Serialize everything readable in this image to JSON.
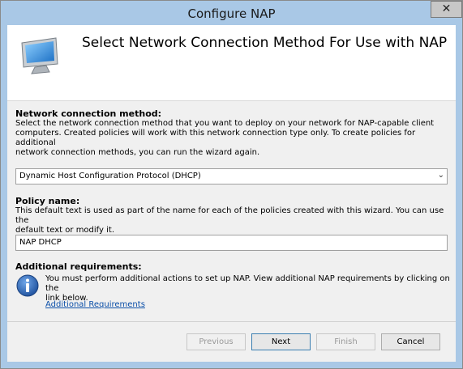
{
  "window": {
    "title": "Configure NAP",
    "close_glyph": "✕"
  },
  "header": {
    "title": "Select Network Connection Method For Use with NAP",
    "icon": "computer-monitor-icon"
  },
  "network_method": {
    "label": "Network connection method:",
    "description_lines": [
      "Select the network connection method that you want to deploy on your network for NAP-capable client",
      "computers. Created policies will work with this network connection type only. To create policies for additional",
      "network connection methods, you can run the wizard again."
    ],
    "selected": "Dynamic Host Configuration Protocol (DHCP)",
    "arrow_glyph": "⌄"
  },
  "policy_name": {
    "label": "Policy name:",
    "description_lines": [
      "This default text is used as part of the name for each of the policies created with this wizard. You can use the",
      "default text or modify it."
    ],
    "value": "NAP DHCP"
  },
  "additional": {
    "label": "Additional requirements:",
    "icon": "info-icon",
    "text_lines": [
      "You must perform additional actions to set up NAP. View additional NAP requirements by clicking on the",
      "link below."
    ],
    "link": "Additional Requirements"
  },
  "buttons": {
    "previous": "Previous",
    "next": "Next",
    "finish": "Finish",
    "cancel": "Cancel"
  }
}
